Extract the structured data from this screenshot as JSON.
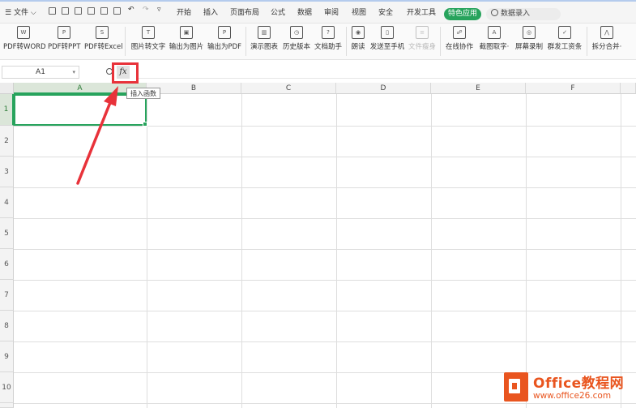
{
  "top_menu": {
    "file_label": "文件",
    "tabs": [
      "开始",
      "插入",
      "页面布局",
      "公式",
      "数据",
      "审阅",
      "视图",
      "安全",
      "开发工具"
    ],
    "special_tab": "特色应用",
    "search_placeholder": "数据录入"
  },
  "ribbon": {
    "tools": [
      {
        "label": "PDF转WORD",
        "icon": "pdf-to-word-icon",
        "glyph": "W",
        "enabled": true
      },
      {
        "label": "PDF转PPT",
        "icon": "pdf-to-ppt-icon",
        "glyph": "P",
        "enabled": true
      },
      {
        "label": "PDF转Excel",
        "icon": "pdf-to-excel-icon",
        "glyph": "S",
        "enabled": true
      },
      {
        "label": "图片转文字",
        "icon": "image-to-text-icon",
        "glyph": "T",
        "enabled": true
      },
      {
        "label": "输出为图片",
        "icon": "export-image-icon",
        "glyph": "▣",
        "enabled": true
      },
      {
        "label": "输出为PDF",
        "icon": "export-pdf-icon",
        "glyph": "P",
        "enabled": true
      },
      {
        "label": "演示图表",
        "icon": "demo-chart-icon",
        "glyph": "▥",
        "enabled": true
      },
      {
        "label": "历史版本",
        "icon": "history-version-icon",
        "glyph": "◷",
        "enabled": true
      },
      {
        "label": "文档助手",
        "icon": "doc-assistant-icon",
        "glyph": "?",
        "enabled": true
      },
      {
        "label": "朗读",
        "icon": "read-aloud-icon",
        "glyph": "◉",
        "enabled": true
      },
      {
        "label": "发送至手机",
        "icon": "send-to-phone-icon",
        "glyph": "▯",
        "enabled": true
      },
      {
        "label": "文件瘦身",
        "icon": "file-slim-icon",
        "glyph": "≡",
        "enabled": false
      },
      {
        "label": "在线协作",
        "icon": "online-collab-icon",
        "glyph": "☍",
        "enabled": true
      },
      {
        "label": "截图取字·",
        "icon": "screenshot-text-icon",
        "glyph": "A",
        "enabled": true
      },
      {
        "label": "屏幕录制",
        "icon": "screen-record-icon",
        "glyph": "◎",
        "enabled": true
      },
      {
        "label": "群发工资条",
        "icon": "payslip-icon",
        "glyph": "✓",
        "enabled": true
      },
      {
        "label": "拆分合并·",
        "icon": "split-merge-icon",
        "glyph": "⋀",
        "enabled": true
      }
    ]
  },
  "formula_bar": {
    "name_box": "A1",
    "fx_label": "fx",
    "tooltip": "插入函数"
  },
  "sheet": {
    "columns": [
      "A",
      "B",
      "C",
      "D",
      "E",
      "F"
    ],
    "rows": [
      "1",
      "2",
      "3",
      "4",
      "5",
      "6",
      "7",
      "8",
      "9",
      "10"
    ],
    "selected_cell": "A1"
  },
  "watermark": {
    "title": "Office教程网",
    "url": "www.office26.com"
  },
  "colors": {
    "accent_green": "#27a35c",
    "annotation_red": "#e8323a",
    "watermark_orange": "#e9551f"
  }
}
